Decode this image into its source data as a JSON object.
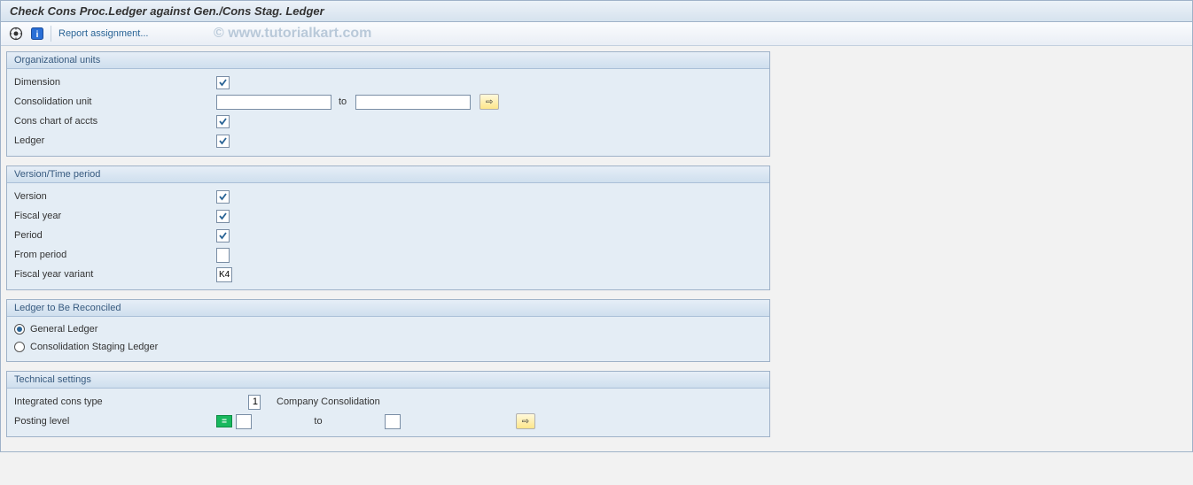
{
  "title": "Check Cons Proc.Ledger against Gen./Cons Stag. Ledger",
  "toolbar": {
    "report_assignment": "Report assignment...",
    "watermark": "© www.tutorialkart.com"
  },
  "groups": {
    "org": {
      "title": "Organizational units",
      "dimension_label": "Dimension",
      "cons_unit_label": "Consolidation unit",
      "cons_unit_from": "",
      "cons_unit_to_label": "to",
      "cons_unit_to": "",
      "cons_chart_label": "Cons chart of accts",
      "ledger_label": "Ledger"
    },
    "version_time": {
      "title": "Version/Time period",
      "version_label": "Version",
      "fiscal_year_label": "Fiscal year",
      "period_label": "Period",
      "from_period_label": "From period",
      "from_period_value": "",
      "fy_variant_label": "Fiscal year variant",
      "fy_variant_value": "K4"
    },
    "reconcile": {
      "title": "Ledger to Be Reconciled",
      "opt_general": "General Ledger",
      "opt_staging": "Consolidation Staging Ledger"
    },
    "technical": {
      "title": "Technical settings",
      "int_cons_type_label": "Integrated cons type",
      "int_cons_type_value": "1",
      "int_cons_type_desc": "Company Consolidation",
      "posting_level_label": "Posting level",
      "posting_level_from": "",
      "posting_level_to_label": "to",
      "posting_level_to": ""
    }
  },
  "glyphs": {
    "check": "☑",
    "arrow": "⇨"
  }
}
